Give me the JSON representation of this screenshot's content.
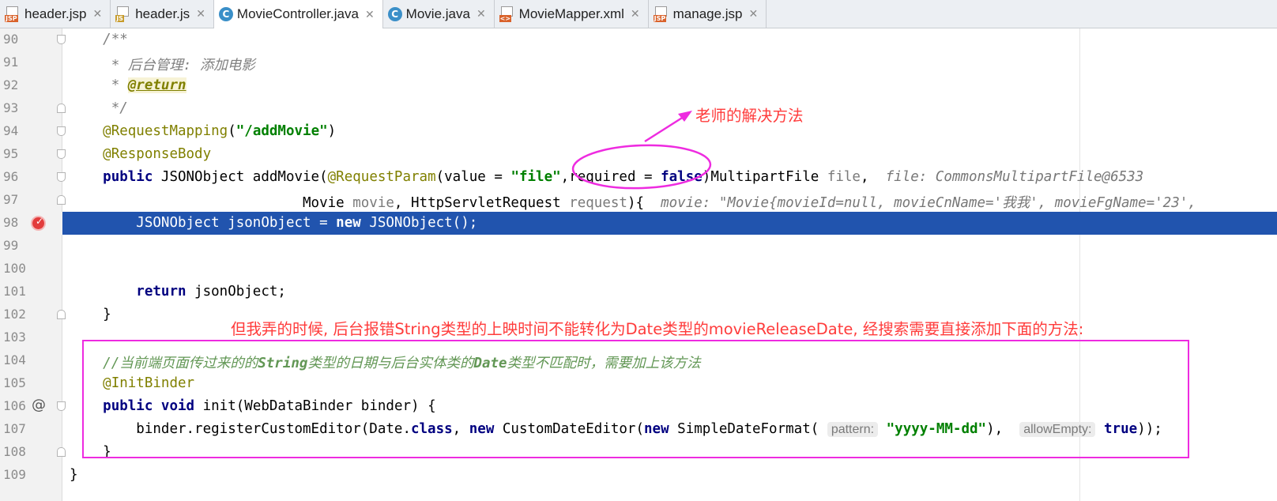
{
  "tabs": [
    {
      "label": "header.jsp",
      "icon": "jsp-file-icon",
      "active": false
    },
    {
      "label": "header.js",
      "icon": "js-file-icon",
      "active": false
    },
    {
      "label": "MovieController.java",
      "icon": "java-class-icon",
      "active": true
    },
    {
      "label": "Movie.java",
      "icon": "java-class-icon",
      "active": false
    },
    {
      "label": "MovieMapper.xml",
      "icon": "xml-file-icon",
      "active": false
    },
    {
      "label": "manage.jsp",
      "icon": "jsp-file-icon",
      "active": false
    }
  ],
  "close_glyph": "✕",
  "icon_letters": {
    "jsp": "JSP",
    "js": "JS",
    "xml": "<>",
    "class": "C"
  },
  "line_numbers": [
    "90",
    "91",
    "92",
    "93",
    "94",
    "95",
    "96",
    "97",
    "98",
    "99",
    "100",
    "101",
    "102",
    "103",
    "104",
    "105",
    "106",
    "107",
    "108",
    "109"
  ],
  "code": {
    "l90": "/**",
    "l91": " * 后台管理: 添加电影",
    "l92_prefix": " * ",
    "l92_tag": "@return",
    "l93": " */",
    "l94_ann": "@RequestMapping",
    "l94_open": "(",
    "l94_str": "\"/addMovie\"",
    "l94_close": ")",
    "l95": "@ResponseBody",
    "l96_kw": "public",
    "l96_a": " JSONObject addMovie(",
    "l96_ann": "@RequestParam",
    "l96_b": "(value = ",
    "l96_str": "\"file\"",
    "l96_c": ",required = ",
    "l96_kw2": "false",
    "l96_d": ")MultipartFile ",
    "l96_param": "file",
    "l96_e": ",  ",
    "l96_hint": "file: CommonsMultipartFile@6533",
    "l97_a": "                        Movie ",
    "l97_param1": "movie",
    "l97_b": ", HttpServletRequest ",
    "l97_param2": "request",
    "l97_c": "){  ",
    "l97_hint": "movie: \"Movie{movieId=null, movieCnName='我我', movieFgName='23',",
    "l98_a": "    JSONObject jsonObject = ",
    "l98_kw": "new",
    "l98_b": " JSONObject();",
    "l101_kw": "return",
    "l101_a": " jsonObject;",
    "l102": "}",
    "l104_a": "//当前端页面传过来的的",
    "l104_b": "String",
    "l104_c": "类型的日期与后台实体类的",
    "l104_d": "Date",
    "l104_e": "类型不匹配时，需要加上该方法",
    "l105": "@InitBinder",
    "l106_kw1": "public",
    "l106_kw2": "void",
    "l106_a": " init(WebDataBinder binder) {",
    "l107_a": "    binder.registerCustomEditor(Date.",
    "l107_kw1": "class",
    "l107_b": ", ",
    "l107_kw2": "new",
    "l107_c": " CustomDateEditor(",
    "l107_kw3": "new",
    "l107_d": " SimpleDateFormat( ",
    "l107_inlay1": "pattern:",
    "l107_str": "\"yyyy-MM-dd\"",
    "l107_e": "),  ",
    "l107_inlay2": "allowEmpty:",
    "l107_kw4": "true",
    "l107_f": "));",
    "l108": "}",
    "l109": "}"
  },
  "annotations": {
    "teacher_note": "老师的解决方法",
    "my_note": "但我弄的时候, 后台报错String类型的上映时间不能转化为Date类型的movieReleaseDate, 经搜索需要直接添加下面的方法:",
    "color": "#ff3b3b",
    "outline_color": "#ee2be0"
  },
  "colors": {
    "highlight_line": "#2154ae",
    "keyword": "#000080",
    "annotation": "#808000",
    "string": "#008000"
  }
}
